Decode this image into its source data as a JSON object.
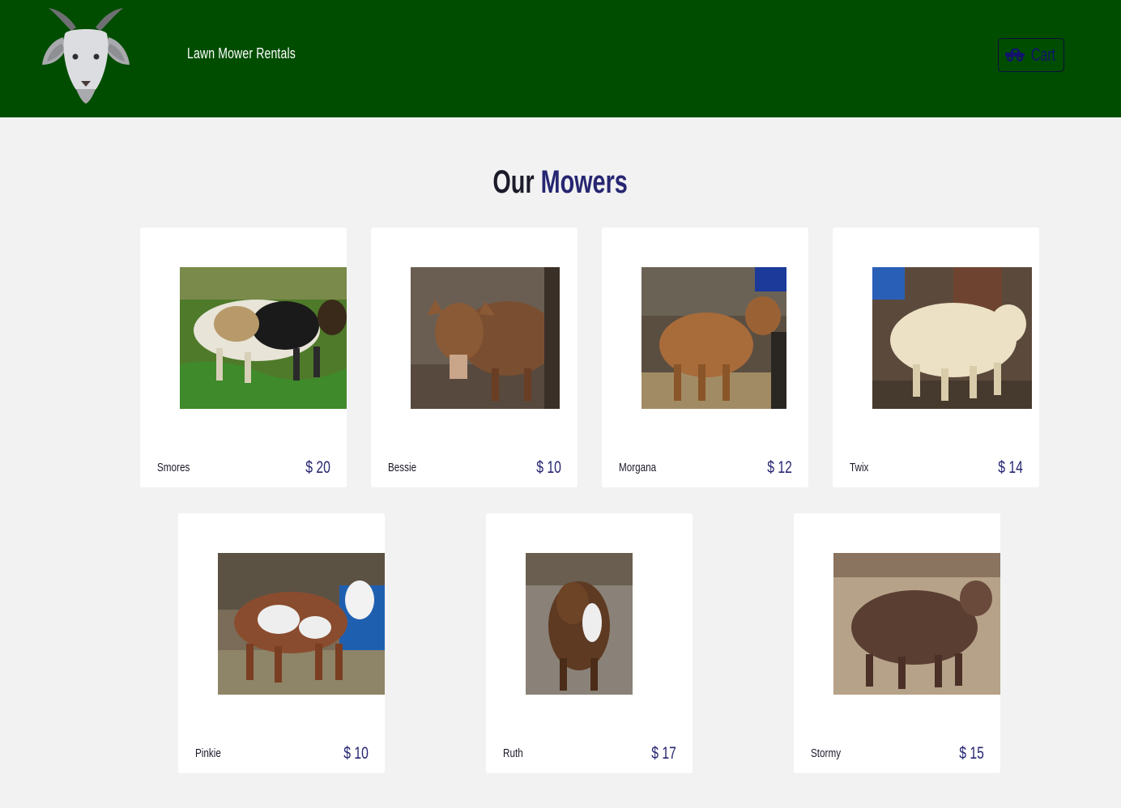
{
  "header": {
    "brand": "Lawn Mower Rentals",
    "logo_icon": "goat-head-icon",
    "cart_label": "Cart",
    "cart_icon": "truck-icon",
    "background_color": "#004d00"
  },
  "section": {
    "title_part1": "Our ",
    "title_part2": "Mowers",
    "accent_color": "#262672"
  },
  "mowers": [
    {
      "name": "Smores",
      "price": "$ 20"
    },
    {
      "name": "Bessie",
      "price": "$ 10"
    },
    {
      "name": "Morgana",
      "price": "$ 12"
    },
    {
      "name": "Twix",
      "price": "$ 14"
    },
    {
      "name": "Pinkie",
      "price": "$ 10"
    },
    {
      "name": "Ruth",
      "price": "$ 17"
    },
    {
      "name": "Stormy",
      "price": "$ 15"
    }
  ]
}
